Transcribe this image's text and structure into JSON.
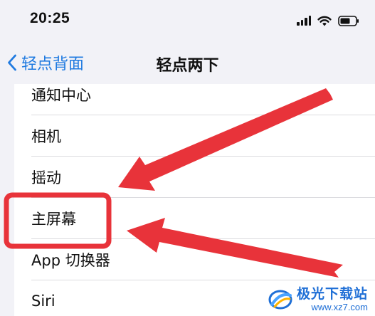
{
  "status_bar": {
    "time": "20:25",
    "icons": [
      "cellular-signal-icon",
      "wifi-icon",
      "battery-icon"
    ]
  },
  "nav": {
    "back_label": "轻点背面",
    "title": "轻点两下"
  },
  "list": {
    "items": [
      {
        "label": "通知中心"
      },
      {
        "label": "相机"
      },
      {
        "label": "摇动"
      },
      {
        "label": "主屏幕",
        "highlighted": true
      },
      {
        "label": "App 切换器"
      },
      {
        "label": "Siri"
      }
    ]
  },
  "annotations": {
    "highlight_color": "#e8333a",
    "arrow_color": "#e8333a",
    "arrow_count": 2
  },
  "watermark": {
    "name": "极光下载站",
    "url": "www.xz7.com",
    "color": "#1f6fd6"
  },
  "colors": {
    "accent": "#1f7ae0",
    "background": "#f2f2f7",
    "card": "#ffffff"
  }
}
